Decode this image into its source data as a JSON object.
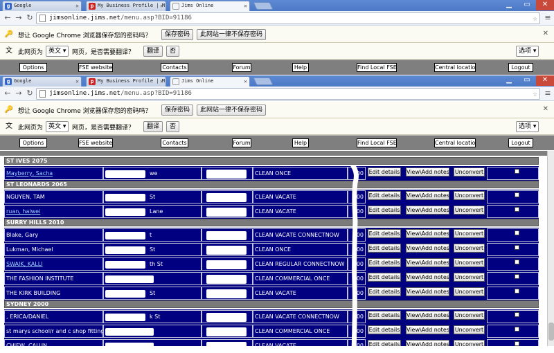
{
  "browser": {
    "tabs": [
      {
        "title": "Google",
        "favicon_letter": "g",
        "favicon_color": "#3366cc"
      },
      {
        "title": "My Business Profile | M",
        "favicon_letter": "p",
        "favicon_color": "#cc2222"
      },
      {
        "title": "Jims Online",
        "favicon_letter": "",
        "favicon_color": "#dddddd"
      }
    ],
    "url_host": "jimsonline.jims.net",
    "url_path": "/menu.asp?BID=91186",
    "password_bar": {
      "text": "想让 Google Chrome 浏览器保存您的密码吗？",
      "save_label": "保存密码",
      "never_label": "此网站一律不保存密码"
    },
    "translate_bar": {
      "prefix": "此网页为",
      "language": "英文",
      "suffix": "网页，是否需要翻译？",
      "translate_label": "翻译",
      "no_label": "否",
      "options_label": "选项"
    }
  },
  "menu": [
    "Options",
    "FSE website",
    "Contacts",
    "Forum",
    "Help",
    "Find Local FSE",
    "Central location",
    "Logout"
  ],
  "actions": {
    "edit": "Edit details",
    "notes": "View\\Add notes",
    "unconvert": "Unconvert"
  },
  "sections": [
    {
      "title": "ST IVES 2075",
      "rows": [
        {
          "name": "Mayberry, Sacha",
          "link": true,
          "addr_tail": "we",
          "service": "CLEAN ONCE",
          "price_tail": "00"
        }
      ]
    },
    {
      "title": "ST LEONARDS 2065",
      "rows": [
        {
          "name": "NGUYEN, TAM",
          "link": false,
          "addr_tail": "St",
          "service": "CLEAN VACATE",
          "price_tail": "00"
        },
        {
          "name": "ruan, haiwei",
          "link": true,
          "addr_tail": "Lane",
          "service": "CLEAN VACATE",
          "price_tail": "00"
        }
      ]
    },
    {
      "title": "SURRY HILLS 2010",
      "rows": [
        {
          "name": "Blake, Gary",
          "link": false,
          "addr_tail": "t",
          "service": "CLEAN VACATE CONNECTNOW",
          "price_tail": "00"
        },
        {
          "name": "Lukman, Michael",
          "link": false,
          "addr_tail": "St",
          "service": "CLEAN ONCE",
          "price_tail": "00"
        },
        {
          "name": "SWAIK, KALLI",
          "link": true,
          "addr_tail": "th St",
          "service": "CLEAN REGULAR CONNECTNOW",
          "price_tail": "00"
        },
        {
          "name": "THE FASHION INSTITUTE",
          "link": false,
          "addr_tail": "",
          "service": "CLEAN COMMERCIAL ONCE",
          "price_tail": "00"
        },
        {
          "name": "THE KIRK BUILDING",
          "link": false,
          "addr_tail": "St",
          "service": "CLEAN VACATE",
          "price_tail": "00"
        }
      ]
    },
    {
      "title": "SYDNEY 2000",
      "rows": [
        {
          "name": ", ERICA/DANIEL",
          "link": false,
          "addr_tail": "k St",
          "service": "CLEAN VACATE CONNECTNOW",
          "price_tail": "00"
        },
        {
          "name": "st marys school/r and c shop fitting",
          "link": false,
          "addr_tail": "",
          "service": "CLEAN COMMERCIAL ONCE",
          "price_tail": "00"
        },
        {
          "name": "CHIEW, CALUN",
          "link": false,
          "addr_tail": "",
          "service": "CLEAN VACATE",
          "price_tail": "00"
        }
      ]
    }
  ]
}
